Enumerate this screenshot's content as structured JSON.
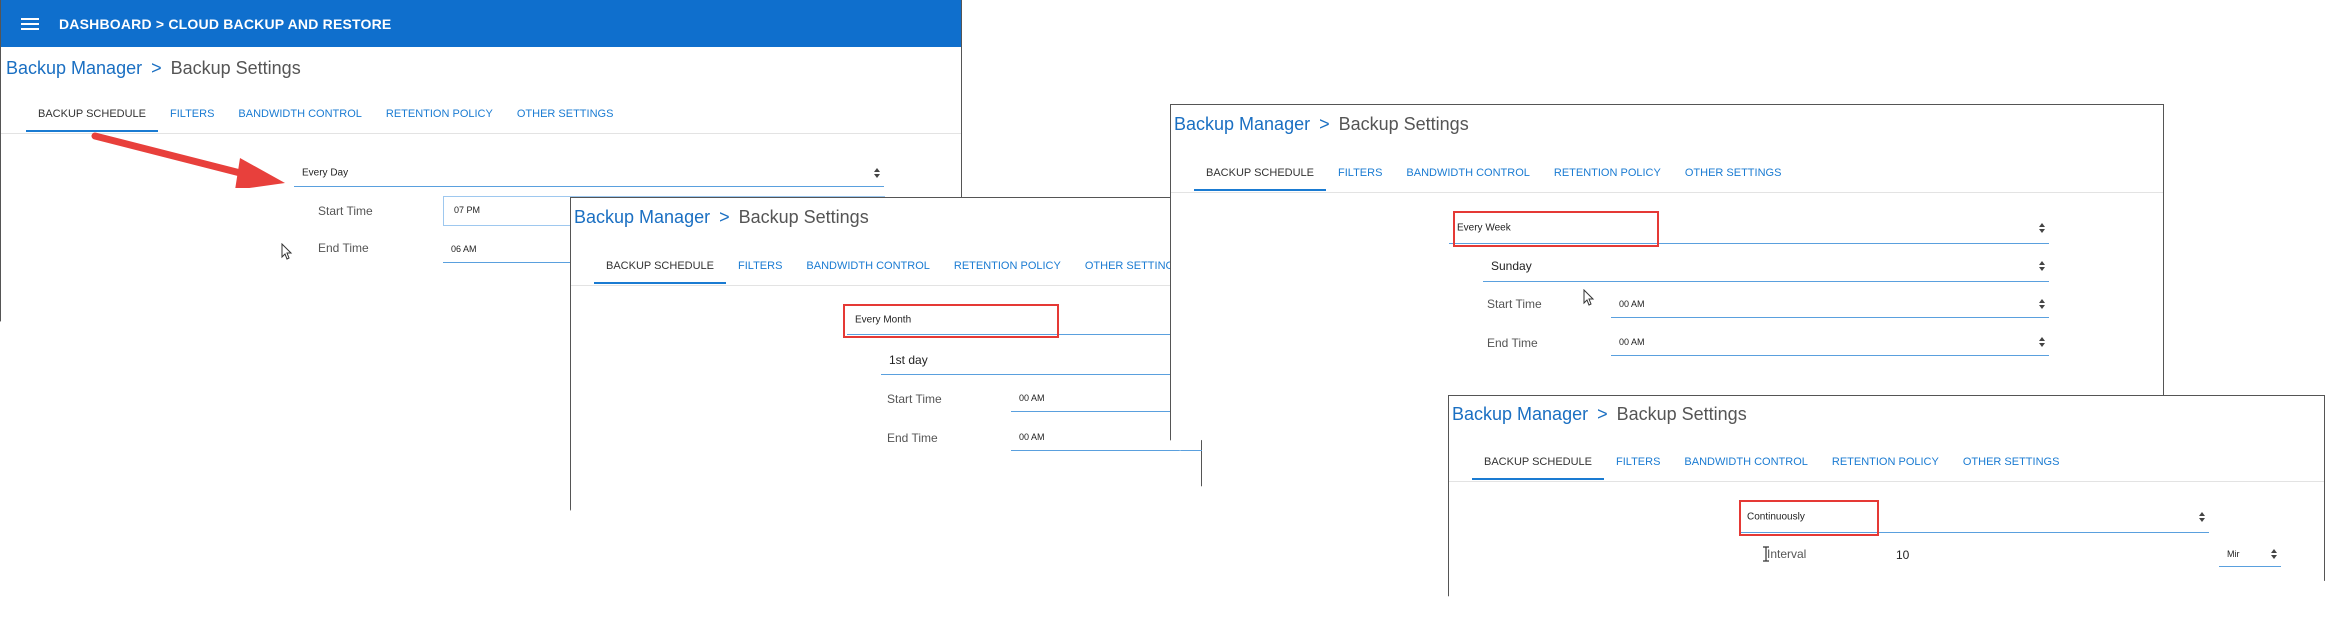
{
  "app": {
    "header_title": "DASHBOARD > CLOUD BACKUP AND RESTORE",
    "breadcrumb_root": "Backup Manager",
    "breadcrumb_separator": ">",
    "breadcrumb_current": "Backup Settings",
    "tabs": [
      "BACKUP SCHEDULE",
      "FILTERS",
      "BANDWIDTH CONTROL",
      "RETENTION POLICY",
      "OTHER SETTINGS"
    ]
  },
  "colors": {
    "header_blue": "#0f6fcd",
    "link_blue": "#1a6fc2",
    "highlight_red": "#e53935",
    "arrow_red": "#e8403c"
  },
  "icons": {
    "menu": "hamburger-icon",
    "dropdown": "select-caret-icon",
    "pointer": "mouse-cursor-icon",
    "text_cursor": "ibeam-cursor-icon",
    "callout": "red-arrow-icon"
  },
  "panel_day": {
    "frequency": "Every Day",
    "start_label": "Start Time",
    "start_value": "07 PM",
    "end_label": "End Time",
    "end_value": "06 AM"
  },
  "panel_month": {
    "frequency": "Every Month",
    "day_value": "1st day",
    "start_label": "Start Time",
    "start_value": "00 AM",
    "end_label": "End Time",
    "end_value": "00 AM"
  },
  "panel_week": {
    "frequency": "Every Week",
    "day_value": "Sunday",
    "start_label": "Start Time",
    "start_value": "00 AM",
    "end_label": "End Time",
    "end_value": "00 AM"
  },
  "panel_continuous": {
    "frequency": "Continuously",
    "interval_label": "Interval",
    "interval_value": "10",
    "unit_value": "Mir"
  }
}
